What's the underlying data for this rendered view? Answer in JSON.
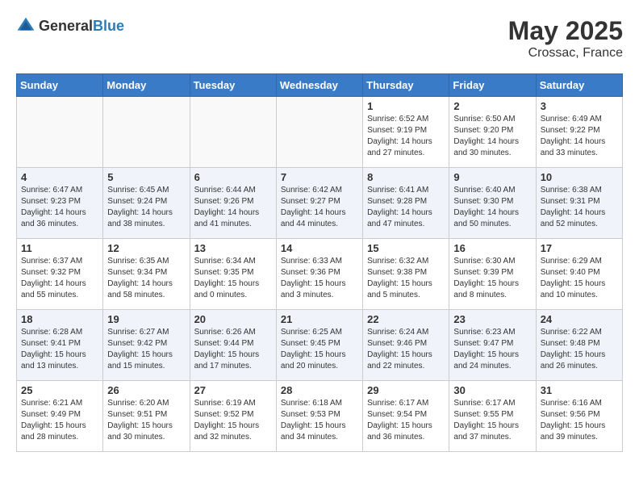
{
  "header": {
    "logo_general": "General",
    "logo_blue": "Blue",
    "month_year": "May 2025",
    "location": "Crossac, France"
  },
  "days_of_week": [
    "Sunday",
    "Monday",
    "Tuesday",
    "Wednesday",
    "Thursday",
    "Friday",
    "Saturday"
  ],
  "weeks": [
    [
      {
        "day": "",
        "info": ""
      },
      {
        "day": "",
        "info": ""
      },
      {
        "day": "",
        "info": ""
      },
      {
        "day": "",
        "info": ""
      },
      {
        "day": "1",
        "info": "Sunrise: 6:52 AM\nSunset: 9:19 PM\nDaylight: 14 hours\nand 27 minutes."
      },
      {
        "day": "2",
        "info": "Sunrise: 6:50 AM\nSunset: 9:20 PM\nDaylight: 14 hours\nand 30 minutes."
      },
      {
        "day": "3",
        "info": "Sunrise: 6:49 AM\nSunset: 9:22 PM\nDaylight: 14 hours\nand 33 minutes."
      }
    ],
    [
      {
        "day": "4",
        "info": "Sunrise: 6:47 AM\nSunset: 9:23 PM\nDaylight: 14 hours\nand 36 minutes."
      },
      {
        "day": "5",
        "info": "Sunrise: 6:45 AM\nSunset: 9:24 PM\nDaylight: 14 hours\nand 38 minutes."
      },
      {
        "day": "6",
        "info": "Sunrise: 6:44 AM\nSunset: 9:26 PM\nDaylight: 14 hours\nand 41 minutes."
      },
      {
        "day": "7",
        "info": "Sunrise: 6:42 AM\nSunset: 9:27 PM\nDaylight: 14 hours\nand 44 minutes."
      },
      {
        "day": "8",
        "info": "Sunrise: 6:41 AM\nSunset: 9:28 PM\nDaylight: 14 hours\nand 47 minutes."
      },
      {
        "day": "9",
        "info": "Sunrise: 6:40 AM\nSunset: 9:30 PM\nDaylight: 14 hours\nand 50 minutes."
      },
      {
        "day": "10",
        "info": "Sunrise: 6:38 AM\nSunset: 9:31 PM\nDaylight: 14 hours\nand 52 minutes."
      }
    ],
    [
      {
        "day": "11",
        "info": "Sunrise: 6:37 AM\nSunset: 9:32 PM\nDaylight: 14 hours\nand 55 minutes."
      },
      {
        "day": "12",
        "info": "Sunrise: 6:35 AM\nSunset: 9:34 PM\nDaylight: 14 hours\nand 58 minutes."
      },
      {
        "day": "13",
        "info": "Sunrise: 6:34 AM\nSunset: 9:35 PM\nDaylight: 15 hours\nand 0 minutes."
      },
      {
        "day": "14",
        "info": "Sunrise: 6:33 AM\nSunset: 9:36 PM\nDaylight: 15 hours\nand 3 minutes."
      },
      {
        "day": "15",
        "info": "Sunrise: 6:32 AM\nSunset: 9:38 PM\nDaylight: 15 hours\nand 5 minutes."
      },
      {
        "day": "16",
        "info": "Sunrise: 6:30 AM\nSunset: 9:39 PM\nDaylight: 15 hours\nand 8 minutes."
      },
      {
        "day": "17",
        "info": "Sunrise: 6:29 AM\nSunset: 9:40 PM\nDaylight: 15 hours\nand 10 minutes."
      }
    ],
    [
      {
        "day": "18",
        "info": "Sunrise: 6:28 AM\nSunset: 9:41 PM\nDaylight: 15 hours\nand 13 minutes."
      },
      {
        "day": "19",
        "info": "Sunrise: 6:27 AM\nSunset: 9:42 PM\nDaylight: 15 hours\nand 15 minutes."
      },
      {
        "day": "20",
        "info": "Sunrise: 6:26 AM\nSunset: 9:44 PM\nDaylight: 15 hours\nand 17 minutes."
      },
      {
        "day": "21",
        "info": "Sunrise: 6:25 AM\nSunset: 9:45 PM\nDaylight: 15 hours\nand 20 minutes."
      },
      {
        "day": "22",
        "info": "Sunrise: 6:24 AM\nSunset: 9:46 PM\nDaylight: 15 hours\nand 22 minutes."
      },
      {
        "day": "23",
        "info": "Sunrise: 6:23 AM\nSunset: 9:47 PM\nDaylight: 15 hours\nand 24 minutes."
      },
      {
        "day": "24",
        "info": "Sunrise: 6:22 AM\nSunset: 9:48 PM\nDaylight: 15 hours\nand 26 minutes."
      }
    ],
    [
      {
        "day": "25",
        "info": "Sunrise: 6:21 AM\nSunset: 9:49 PM\nDaylight: 15 hours\nand 28 minutes."
      },
      {
        "day": "26",
        "info": "Sunrise: 6:20 AM\nSunset: 9:51 PM\nDaylight: 15 hours\nand 30 minutes."
      },
      {
        "day": "27",
        "info": "Sunrise: 6:19 AM\nSunset: 9:52 PM\nDaylight: 15 hours\nand 32 minutes."
      },
      {
        "day": "28",
        "info": "Sunrise: 6:18 AM\nSunset: 9:53 PM\nDaylight: 15 hours\nand 34 minutes."
      },
      {
        "day": "29",
        "info": "Sunrise: 6:17 AM\nSunset: 9:54 PM\nDaylight: 15 hours\nand 36 minutes."
      },
      {
        "day": "30",
        "info": "Sunrise: 6:17 AM\nSunset: 9:55 PM\nDaylight: 15 hours\nand 37 minutes."
      },
      {
        "day": "31",
        "info": "Sunrise: 6:16 AM\nSunset: 9:56 PM\nDaylight: 15 hours\nand 39 minutes."
      }
    ]
  ]
}
